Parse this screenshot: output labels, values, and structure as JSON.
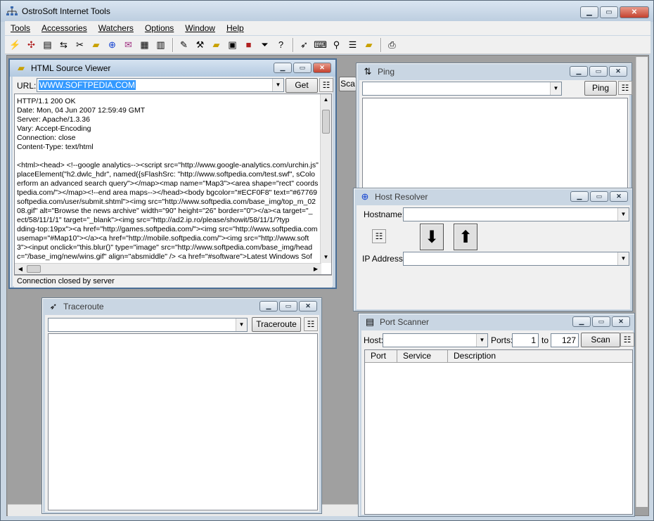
{
  "app": {
    "title": "OstroSoft Internet Tools"
  },
  "menu": [
    "Tools",
    "Accessories",
    "Watchers",
    "Options",
    "Window",
    "Help"
  ],
  "toolbar_icons": [
    "network-icon",
    "network-map-icon",
    "document-icon",
    "transfer-icon",
    "scan-icon",
    "notes-icon",
    "add-icon",
    "mail-icon",
    "print-device-icon",
    "chart-icon",
    "edit-icon",
    "tools-icon",
    "memo-icon",
    "book-icon",
    "cube-icon",
    "filter-icon",
    "help-icon",
    "route-icon",
    "keyboard-icon",
    "search-icon",
    "list-icon",
    "note-icon",
    "printer-icon"
  ],
  "html_source_viewer": {
    "title": "HTML Source Viewer",
    "url_label": "URL:",
    "url_value": "WWW.SOFTPEDIA.COM",
    "get_button": "Get",
    "source_text": "HTTP/1.1 200 OK\nDate: Mon, 04 Jun 2007 12:59:49 GMT\nServer: Apache/1.3.36\nVary: Accept-Encoding\nConnection: close\nContent-Type: text/html\n\n<html><head> <!--google analytics--><script src=\"http://www.google-analytics.com/urchin.js\"\nplaceElement(\"h2.dwlc_hdr\", named({sFlashSrc: \"http://www.softpedia.com/test.swf\", sColo\nerform an advanced search query\"></map><map name=\"Map3\"><area shape=\"rect\" coords\ntpedia.com/\"></map><!--end area maps--></head><body bgcolor=\"#ECF0F8\" text=\"#67769\nsoftpedia.com/user/submit.shtml\"><img src=\"http://www.softpedia.com/base_img/top_m_02\n08.gif\" alt=\"Browse the news archive\" width=\"90\" height=\"26\" border=\"0\"></a><a target=\"_\nect/58/11/1/1\" target=\"_blank\"><img src=\"http://ad2.ip.ro/please/showit/58/11/1/?typ\ndding-top:19px\"><a href=\"http://games.softpedia.com/\"><img src=\"http://www.softpedia.com\nusemap=\"#Map10\"></a><a href=\"http://mobile.softpedia.com/\"><img src=\"http://www.soft\n3\"><input onclick=\"this.blur()\" type=\"image\" src=\"http://www.softpedia.com/base_img/head\nc=\"/base_img/new/wins.gif\" align=\"absmiddle\" /> <a href=\"#software\">Latest Windows Sof",
    "status": "Connection closed by server"
  },
  "ping": {
    "title": "Ping",
    "button": "Ping"
  },
  "scan_partial": "Sca",
  "host_resolver": {
    "title": "Host Resolver",
    "hostname_label": "Hostname:",
    "ip_label": "IP Address:"
  },
  "traceroute": {
    "title": "Traceroute",
    "button": "Traceroute"
  },
  "port_scanner": {
    "title": "Port Scanner",
    "host_label": "Host:",
    "ports_label": "Ports:",
    "port_from": "1",
    "to_label": "to",
    "port_to": "127",
    "scan_button": "Scan",
    "columns": [
      "Port",
      "Service",
      "Description"
    ]
  },
  "colors": {
    "selection": "#3399ff",
    "title_active": "#bccddf"
  }
}
